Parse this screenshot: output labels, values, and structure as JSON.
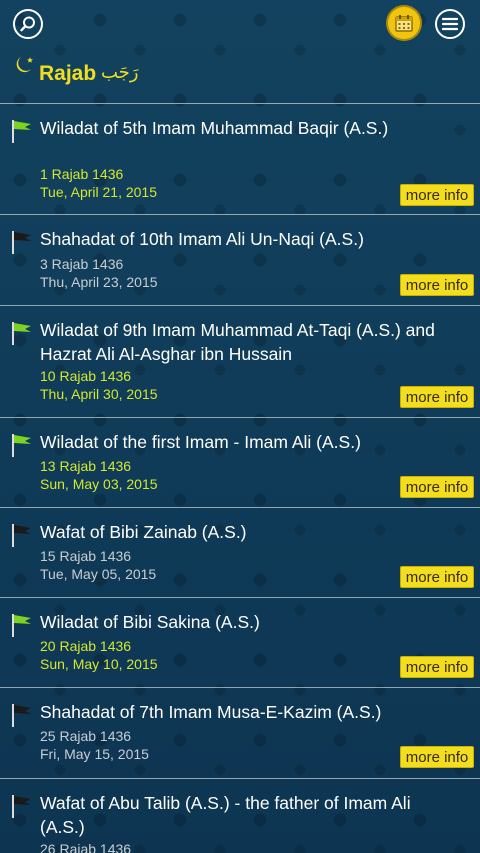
{
  "month": {
    "name": "Rajab",
    "arabic": "رَجَب"
  },
  "more_info_label": "more info",
  "events": [
    {
      "title": "Wiladat of 5th Imam Muhammad Baqir (A.S.)",
      "hijri": "1 Rajab 1436",
      "gregorian": "Tue, April 21, 2015",
      "type": "wiladat"
    },
    {
      "title": "Shahadat of 10th Imam Ali Un-Naqi (A.S.)",
      "hijri": "3 Rajab 1436",
      "gregorian": "Thu, April 23, 2015",
      "type": "shahadat"
    },
    {
      "title": "Wiladat of 9th Imam Muhammad At-Taqi (A.S.) and Hazrat Ali Al-Asghar ibn Hussain",
      "hijri": "10 Rajab 1436",
      "gregorian": "Thu, April 30, 2015",
      "type": "wiladat"
    },
    {
      "title": "Wiladat of the first Imam - Imam Ali (A.S.)",
      "hijri": "13 Rajab 1436",
      "gregorian": "Sun, May 03, 2015",
      "type": "wiladat"
    },
    {
      "title": "Wafat of Bibi Zainab (A.S.)",
      "hijri": "15 Rajab 1436",
      "gregorian": "Tue, May 05, 2015",
      "type": "shahadat"
    },
    {
      "title": "Wiladat of Bibi Sakina (A.S.)",
      "hijri": "20 Rajab 1436",
      "gregorian": "Sun, May 10, 2015",
      "type": "wiladat"
    },
    {
      "title": "Shahadat of 7th Imam Musa-E-Kazim (A.S.)",
      "hijri": "25 Rajab 1436",
      "gregorian": "Fri, May 15, 2015",
      "type": "shahadat"
    },
    {
      "title": "Wafat of Abu Talib (A.S.) - the father of Imam Ali (A.S.)",
      "hijri": "26 Rajab 1436",
      "gregorian": "",
      "type": "shahadat"
    }
  ],
  "colors": {
    "background": "#0f3a58",
    "accent_yellow": "#f2de1f",
    "green_flag": "#7dd321",
    "black_flag": "#1a1a1a",
    "date_green": "#d3e82e",
    "date_gray": "#c9cdd1"
  },
  "icons": [
    "search-icon",
    "calendar-icon",
    "menu-icon",
    "crescent-moon-icon",
    "green-flag-icon",
    "black-flag-icon"
  ]
}
